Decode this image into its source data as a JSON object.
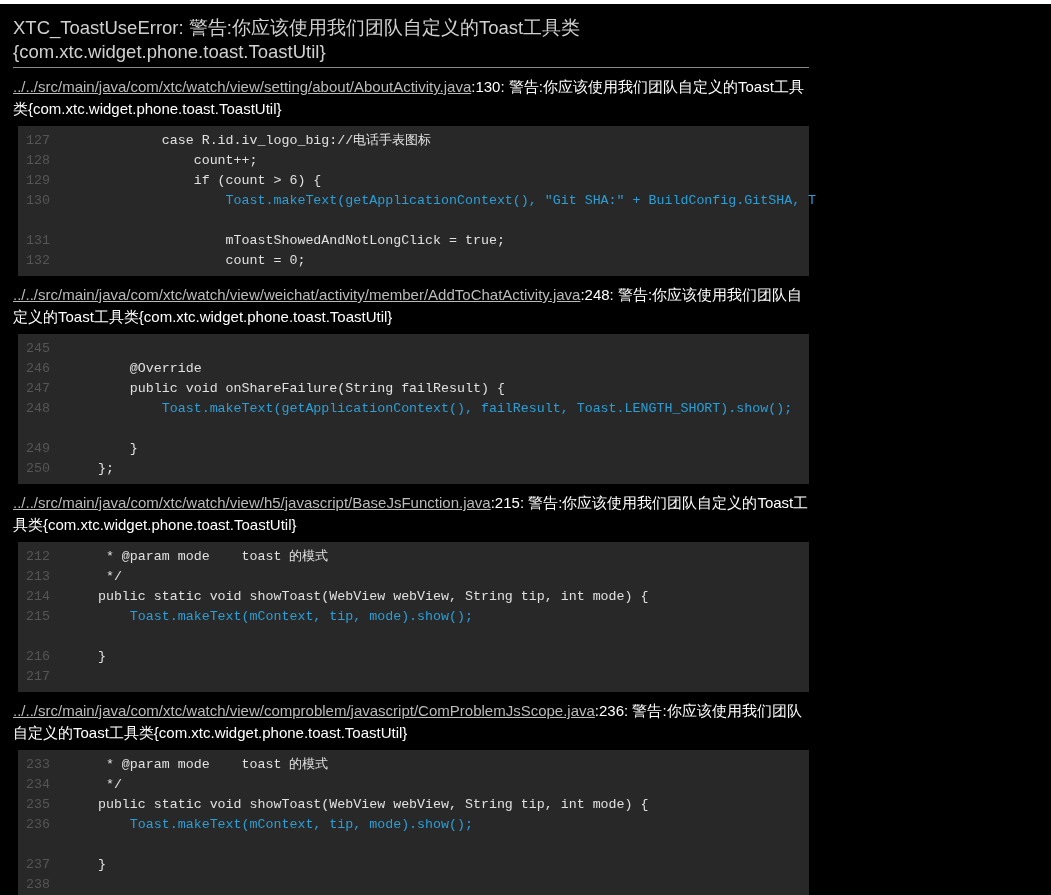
{
  "report": {
    "title": "XTC_ToastUseError: 警告:你应该使用我们团队自定义的Toast工具类{com.xtc.widget.phone.toast.ToastUtil}"
  },
  "issues": [
    {
      "file": "../../src/main/java/com/xtc/watch/view/setting/about/AboutActivity.java",
      "message": ":130: 警告:你应该使用我们团队自定义的Toast工具类{com.xtc.widget.phone.toast.ToastUtil}",
      "code": [
        {
          "kind": "normal",
          "number": "127",
          "text": "            case R.id.iv_logo_big://电话手表图标"
        },
        {
          "kind": "normal",
          "number": "128",
          "text": "                count++;"
        },
        {
          "kind": "normal",
          "number": "129",
          "text": "                if (count > 6) {"
        },
        {
          "kind": "highlight",
          "number": "130",
          "text": "                    Toast.makeText(getApplicationContext(), \"Git SHA:\" + BuildConfig.GitSHA, T"
        },
        {
          "kind": "gap"
        },
        {
          "kind": "normal",
          "number": "131",
          "text": "                    mToastShowedAndNotLongClick = true;"
        },
        {
          "kind": "normal",
          "number": "132",
          "text": "                    count = 0;"
        }
      ]
    },
    {
      "file": "../../src/main/java/com/xtc/watch/view/weichat/activity/member/AddToChatActivity.java",
      "message": ":248: 警告:你应该使用我们团队自定义的Toast工具类{com.xtc.widget.phone.toast.ToastUtil}",
      "code": [
        {
          "kind": "normal",
          "number": "245"
        },
        {
          "kind": "normal",
          "number": "246",
          "text": "        @Override"
        },
        {
          "kind": "normal",
          "number": "247",
          "text": "        public void onShareFailure(String failResult) {"
        },
        {
          "kind": "highlight",
          "number": "248",
          "text": "            Toast.makeText(getApplicationContext(), failResult, Toast.LENGTH_SHORT).show();"
        },
        {
          "kind": "gap"
        },
        {
          "kind": "normal",
          "number": "249",
          "text": "        }"
        },
        {
          "kind": "normal",
          "number": "250",
          "text": "    };"
        }
      ]
    },
    {
      "file": "../../src/main/java/com/xtc/watch/view/h5/javascript/BaseJsFunction.java",
      "message": ":215: 警告:你应该使用我们团队自定义的Toast工具类{com.xtc.widget.phone.toast.ToastUtil}",
      "code": [
        {
          "kind": "normal",
          "number": "212",
          "text": "     * @param mode    toast 的模式"
        },
        {
          "kind": "normal",
          "number": "213",
          "text": "     */"
        },
        {
          "kind": "normal",
          "number": "214",
          "text": "    public static void showToast(WebView webView, String tip, int mode) {"
        },
        {
          "kind": "highlight",
          "number": "215",
          "text": "        Toast.makeText(mContext, tip, mode).show();"
        },
        {
          "kind": "gap"
        },
        {
          "kind": "normal",
          "number": "216",
          "text": "    }"
        },
        {
          "kind": "normal",
          "number": "217"
        }
      ]
    },
    {
      "file": "../../src/main/java/com/xtc/watch/view/comproblem/javascript/ComProblemJsScope.java",
      "message": ":236: 警告:你应该使用我们团队自定义的Toast工具类{com.xtc.widget.phone.toast.ToastUtil}",
      "code": [
        {
          "kind": "normal",
          "number": "233",
          "text": "     * @param mode    toast 的模式"
        },
        {
          "kind": "normal",
          "number": "234",
          "text": "     */"
        },
        {
          "kind": "normal",
          "number": "235",
          "text": "    public static void showToast(WebView webView, String tip, int mode) {"
        },
        {
          "kind": "highlight",
          "number": "236",
          "text": "        Toast.makeText(mContext, tip, mode).show();"
        },
        {
          "kind": "gap"
        },
        {
          "kind": "normal",
          "number": "237",
          "text": "    }"
        },
        {
          "kind": "normal",
          "number": "238"
        }
      ]
    }
  ]
}
